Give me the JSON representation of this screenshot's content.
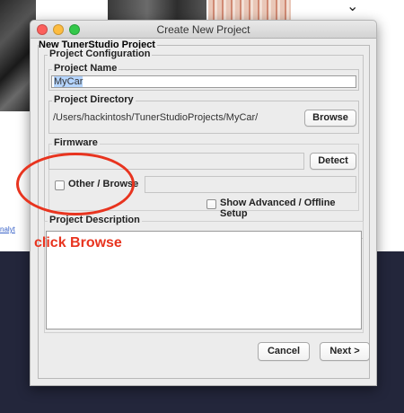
{
  "background": {
    "sidebar_link": "nalyt"
  },
  "window": {
    "title": "Create New Project",
    "outer_legend": "New TunerStudio Project",
    "config_legend": "Project Configuration"
  },
  "project_name": {
    "label": "Project Name",
    "value": "MyCar"
  },
  "project_directory": {
    "label": "Project Directory",
    "value": "/Users/hackintosh/TunerStudioProjects/MyCar/",
    "browse_label": "Browse"
  },
  "firmware": {
    "label": "Firmware",
    "value": "",
    "detect_label": "Detect",
    "other_browse_label": "Other / Browse",
    "other_browse_checked": false,
    "show_advanced_label": "Show Advanced / Offline Setup",
    "show_advanced_checked": false
  },
  "project_description": {
    "label": "Project Description",
    "value": ""
  },
  "footer": {
    "cancel_label": "Cancel",
    "next_label": "Next >"
  },
  "annotation": {
    "text": "click Browse",
    "color": "#e8341f"
  },
  "colors": {
    "accent_annotation": "#e8341f",
    "traffic_close": "#fc605c",
    "traffic_min": "#fdbc40",
    "traffic_max": "#34c84a",
    "page_dark": "#23263b"
  }
}
